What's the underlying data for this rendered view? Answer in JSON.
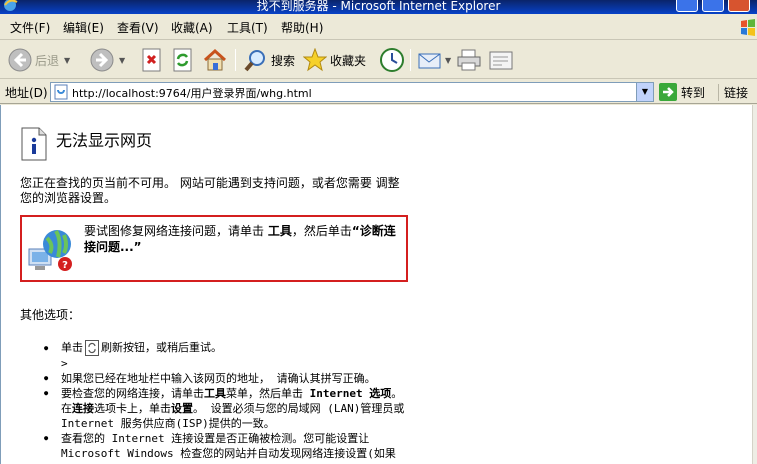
{
  "window": {
    "title": "找不到服务器 - Microsoft Internet Explorer"
  },
  "menu": [
    "文件(F)",
    "编辑(E)",
    "查看(V)",
    "收藏(A)",
    "工具(T)",
    "帮助(H)"
  ],
  "toolbar": {
    "back": "后退",
    "search": "搜索",
    "favorites": "收藏夹"
  },
  "address": {
    "label": "地址(D)",
    "url": "http://localhost:9764/用户登录界面/whg.html",
    "go": "转到",
    "links": "链接"
  },
  "page": {
    "heading": "无法显示网页",
    "intro": "您正在查找的页当前不可用。 网站可能遇到支持问题，或者您需要 调整您的浏览器设置。",
    "diag_text": "要试图修复网络连接问题，请单击",
    "diag_tools": "工具",
    "diag_then": "，然后单击",
    "diag_action": "“诊断连接问题...”",
    "other_options": "其他选项：",
    "b1_pre": "单击",
    "b1_post": "刷新按钮，或稍后重试。",
    "caret": ">",
    "b2": "如果您已经在地址栏中输入该网页的地址， 请确认其拼写正确。",
    "b3_pre": "要检查您的网络连接，请单击",
    "b3_tools": "工具",
    "b3_mid": "菜单，然后单击",
    "b3_internet_options": "Internet 选项",
    "b3_in": "。在",
    "b3_connections": "连接",
    "b3_tab": "选项卡上，单击",
    "b3_settings": "设置",
    "b3_rest": "。 设置必须与您的局域网 (LAN)管理员或 Internet 服务供应商(ISP)提供的一致。",
    "b4": "查看您的 Internet 连接设置是否正确被检测。您可能设置让 Microsoft Windows 检查您的网站并自动发现网络连接设置(如果"
  }
}
